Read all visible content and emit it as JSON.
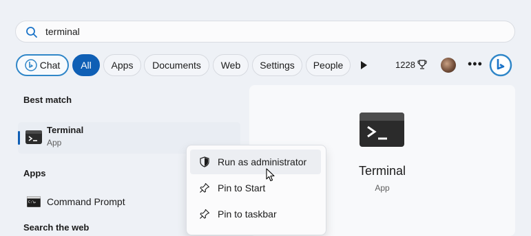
{
  "search": {
    "query": "terminal"
  },
  "filters": {
    "chat": "Chat",
    "all": "All",
    "apps": "Apps",
    "documents": "Documents",
    "web": "Web",
    "settings": "Settings",
    "people": "People"
  },
  "rewards": {
    "points": "1228"
  },
  "best_match": {
    "section": "Best match",
    "title": "Terminal",
    "subtitle": "App"
  },
  "apps_section": {
    "section": "Apps",
    "items": [
      {
        "label": "Command Prompt"
      }
    ]
  },
  "web_section": {
    "section": "Search the web"
  },
  "detail": {
    "title": "Terminal",
    "subtitle": "App"
  },
  "context_menu": {
    "items": [
      {
        "label": "Run as administrator",
        "icon": "shield-icon"
      },
      {
        "label": "Pin to Start",
        "icon": "pin-icon"
      },
      {
        "label": "Pin to taskbar",
        "icon": "pin-icon"
      }
    ]
  },
  "colors": {
    "accent": "#0f5fb5",
    "chat_border": "#2f86c8"
  }
}
